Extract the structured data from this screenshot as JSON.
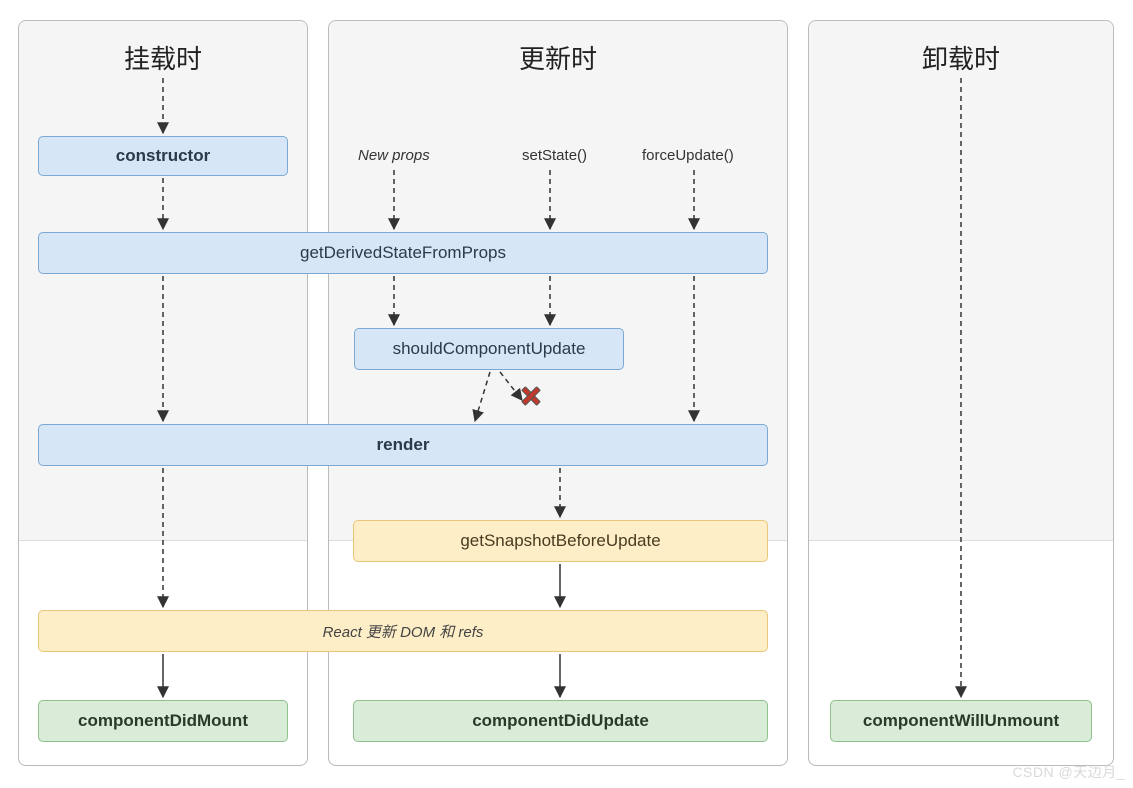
{
  "columns": {
    "mount": {
      "title": "挂载时"
    },
    "update": {
      "title": "更新时"
    },
    "unmount": {
      "title": "卸载时"
    }
  },
  "update_triggers": {
    "new_props": "New props",
    "set_state": "setState()",
    "force_update": "forceUpdate()"
  },
  "lifecycle": {
    "constructor": "constructor",
    "getDerived": "getDerivedStateFromProps",
    "shouldUpdate": "shouldComponentUpdate",
    "render": "render",
    "getSnapshot": "getSnapshotBeforeUpdate",
    "react_updates": "React 更新 DOM 和 refs",
    "didMount": "componentDidMount",
    "didUpdate": "componentDidUpdate",
    "willUnmount": "componentWillUnmount"
  },
  "watermark": "CSDN @天边月_"
}
